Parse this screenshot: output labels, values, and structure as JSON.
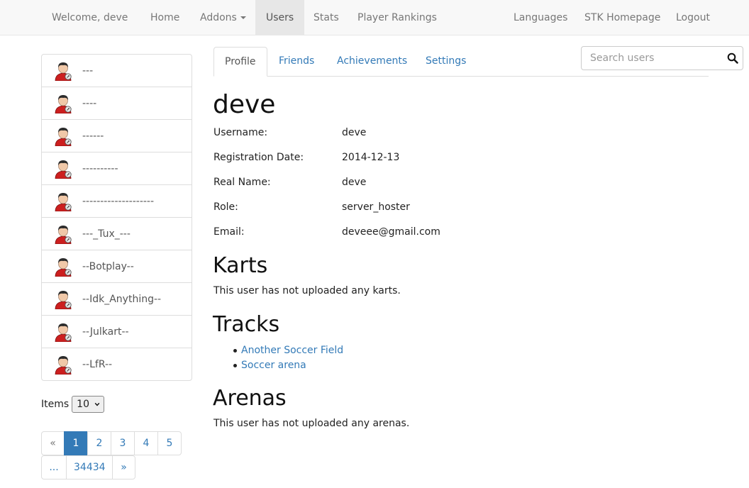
{
  "navbar": {
    "welcome": "Welcome, deve",
    "items": [
      {
        "label": "Home"
      },
      {
        "label": "Addons"
      },
      {
        "label": "Users"
      },
      {
        "label": "Stats"
      },
      {
        "label": "Player Rankings"
      }
    ],
    "right_items": [
      {
        "label": "Languages"
      },
      {
        "label": "STK Homepage"
      },
      {
        "label": "Logout"
      }
    ],
    "active": "Users"
  },
  "users": [
    {
      "name": "---"
    },
    {
      "name": "----"
    },
    {
      "name": "------"
    },
    {
      "name": "----------"
    },
    {
      "name": "--------------------"
    },
    {
      "name": "---_Tux_---"
    },
    {
      "name": "--Botplay--"
    },
    {
      "name": "--Idk_Anything--"
    },
    {
      "name": "--Julkart--"
    },
    {
      "name": "--LfR--"
    }
  ],
  "items_per_page": {
    "label": "Items",
    "value": "10"
  },
  "pagination": {
    "row1": [
      "«",
      "1",
      "2",
      "3",
      "4",
      "5"
    ],
    "row2": [
      "...",
      "34434",
      "»"
    ],
    "current": "1"
  },
  "tabs": [
    {
      "label": "Profile"
    },
    {
      "label": "Friends"
    },
    {
      "label": "Achievements"
    },
    {
      "label": "Settings"
    }
  ],
  "search": {
    "placeholder": "Search users",
    "value": ""
  },
  "profile": {
    "title": "deve",
    "fields": [
      {
        "label": "Username:",
        "value": "deve"
      },
      {
        "label": "Registration Date:",
        "value": "2014-12-13"
      },
      {
        "label": "Real Name:",
        "value": "deve"
      },
      {
        "label": "Role:",
        "value": "server_hoster"
      },
      {
        "label": "Email:",
        "value": "deveee@gmail.com"
      }
    ],
    "karts_heading": "Karts",
    "karts_text": "This user has not uploaded any karts.",
    "tracks_heading": "Tracks",
    "tracks": [
      "Another Soccer Field",
      "Soccer arena"
    ],
    "arenas_heading": "Arenas",
    "arenas_text": "This user has not uploaded any arenas."
  },
  "colors": {
    "link": "#337ab7",
    "navbar_bg": "#f8f8f8",
    "active_nav_bg": "#e7e7e7",
    "avatar_shirt": "#cc1f1f"
  }
}
